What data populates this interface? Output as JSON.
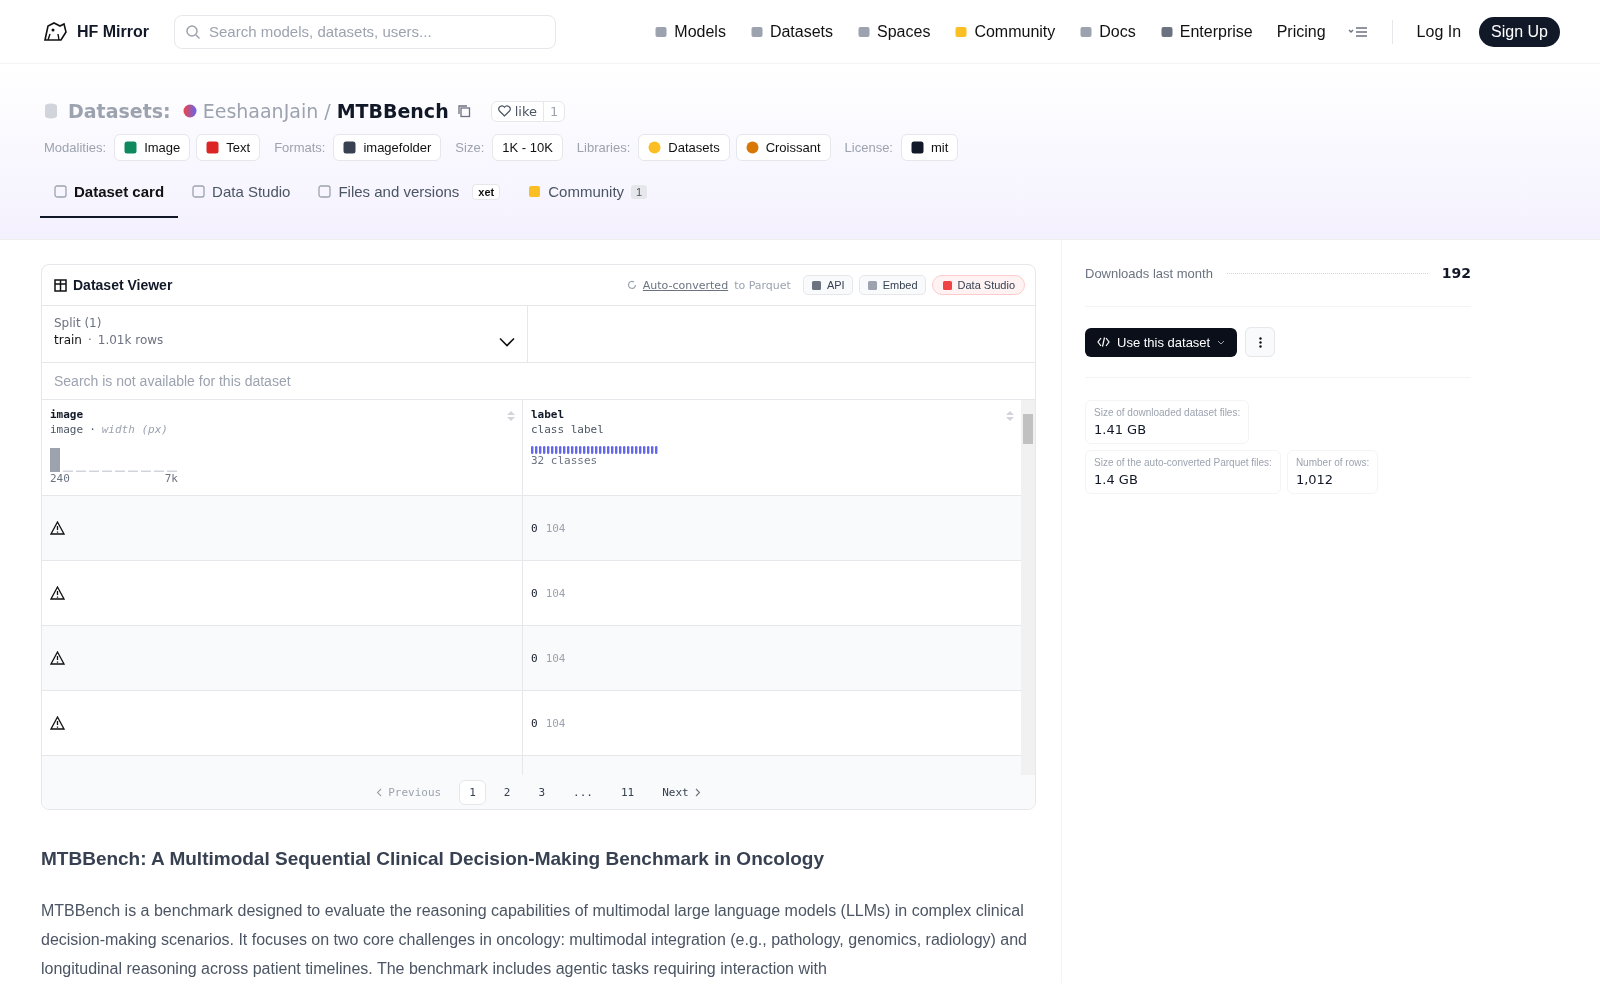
{
  "header": {
    "brand": "HF Mirror",
    "search": {
      "placeholder": "Search models, datasets, users..."
    },
    "nav": [
      {
        "label": "Models",
        "kind": "models"
      },
      {
        "label": "Datasets",
        "kind": "datasets"
      },
      {
        "label": "Spaces",
        "kind": "spaces"
      },
      {
        "label": "Community",
        "kind": "community"
      },
      {
        "label": "Docs",
        "kind": "docs"
      },
      {
        "label": "Enterprise",
        "kind": "enterprise"
      },
      {
        "label": "Pricing",
        "kind": "plain"
      }
    ],
    "login": "Log In",
    "signup": "Sign Up"
  },
  "repo": {
    "type_label": "Datasets:",
    "owner": "EeshaanJain",
    "separator": "/",
    "name": "MTBBench",
    "like": "like",
    "likes": "1",
    "tag_groups": [
      {
        "label": "Modalities:",
        "tags": [
          {
            "label": "Image",
            "kind": "image"
          },
          {
            "label": "Text",
            "kind": "text"
          }
        ]
      },
      {
        "label": "Formats:",
        "tags": [
          {
            "label": "imagefolder",
            "kind": "folder"
          }
        ]
      },
      {
        "label": "Size:",
        "tags": [
          {
            "label": "1K - 10K",
            "kind": "plain"
          }
        ]
      },
      {
        "label": "Libraries:",
        "tags": [
          {
            "label": "Datasets",
            "kind": "hug"
          },
          {
            "label": "Croissant",
            "kind": "croissant"
          }
        ]
      },
      {
        "label": "License:",
        "tags": [
          {
            "label": "mit",
            "kind": "license"
          }
        ]
      }
    ]
  },
  "tabs": [
    {
      "label": "Dataset card",
      "kind": "card",
      "selected": true
    },
    {
      "label": "Data Studio",
      "kind": "studio",
      "selected": false
    },
    {
      "label": "Files and versions",
      "kind": "files",
      "badge": "xet",
      "selected": false
    },
    {
      "label": "Community",
      "kind": "community",
      "count": "1",
      "selected": false
    }
  ],
  "viewer": {
    "title": "Dataset Viewer",
    "auto_link": "Auto-converted",
    "auto_rest": "to Parquet",
    "buttons": [
      {
        "label": "API",
        "kind": "api"
      },
      {
        "label": "Embed",
        "kind": "embed"
      },
      {
        "label": "Data Studio",
        "kind": "studio"
      }
    ],
    "split": {
      "label": "Split (1)",
      "name": "train",
      "separator": "·",
      "rows": "1.01k rows"
    },
    "search_notice": "Search is not available for this dataset",
    "columns": [
      {
        "name": "image",
        "type": "image",
        "type_separator": "·",
        "type_note": "width (px)",
        "kind": "histogram",
        "min": "240",
        "max": "7k"
      },
      {
        "name": "label",
        "type": "class label",
        "kind": "classes",
        "summary": "32 classes"
      }
    ],
    "rows": [
      {
        "label": "0",
        "label_name": "104"
      },
      {
        "label": "0",
        "label_name": "104"
      },
      {
        "label": "0",
        "label_name": "104"
      },
      {
        "label": "0",
        "label_name": "104"
      }
    ],
    "pagination": {
      "previous": "Previous",
      "pages": [
        {
          "label": "1",
          "selected": true
        },
        {
          "label": "2",
          "selected": false
        },
        {
          "label": "3",
          "selected": false
        },
        {
          "label": "...",
          "selected": false
        },
        {
          "label": "11",
          "selected": false
        }
      ],
      "next": "Next"
    }
  },
  "card": {
    "heading": "MTBBench: A Multimodal Sequential Clinical Decision-Making Benchmark in Oncology",
    "paragraph": "MTBBench is a benchmark designed to evaluate the reasoning capabilities of multimodal large language models (LLMs) in complex clinical decision-making scenarios. It focuses on two core challenges in oncology: multimodal integration (e.g., pathology, genomics, radiology) and longitudinal reasoning across patient timelines. The benchmark includes agentic tasks requiring interaction with"
  },
  "sidebar": {
    "downloads_label": "Downloads last month",
    "downloads": "192",
    "use_button": "Use this dataset",
    "stats": [
      {
        "label": "Size of downloaded dataset files:",
        "value": "1.41 GB"
      },
      {
        "label": "Size of the auto-converted Parquet files:",
        "value": "1.4 GB"
      },
      {
        "label": "Number of rows:",
        "value": "1,012"
      }
    ]
  }
}
